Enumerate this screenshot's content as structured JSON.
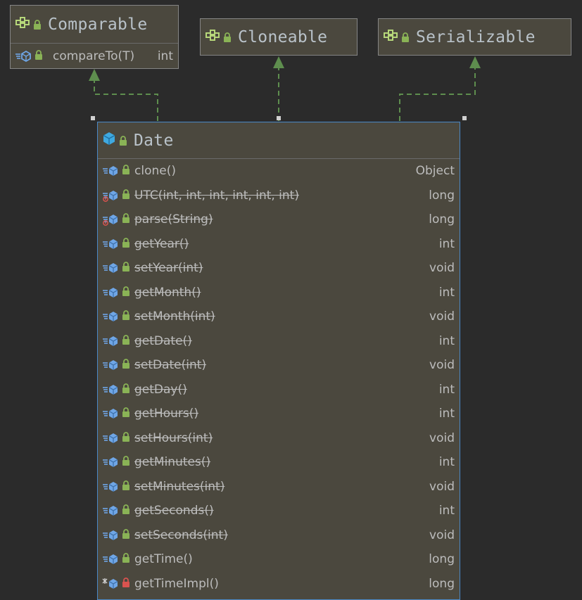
{
  "diagram": {
    "interfaces": [
      {
        "id": "comparable",
        "name": "Comparable",
        "members": [
          {
            "name": "compareTo(T)",
            "type": "int"
          }
        ]
      },
      {
        "id": "cloneable",
        "name": "Cloneable",
        "members": []
      },
      {
        "id": "serializable",
        "name": "Serializable",
        "members": []
      }
    ],
    "class": {
      "name": "Date",
      "methods": [
        {
          "name": "clone()",
          "type": "Object",
          "deprecated": false,
          "mark": ""
        },
        {
          "name": "UTC(int, int, int, int, int, int)",
          "type": "long",
          "deprecated": true,
          "mark": "static"
        },
        {
          "name": "parse(String)",
          "type": "long",
          "deprecated": true,
          "mark": "static"
        },
        {
          "name": "getYear()",
          "type": "int",
          "deprecated": true,
          "mark": ""
        },
        {
          "name": "setYear(int)",
          "type": "void",
          "deprecated": true,
          "mark": ""
        },
        {
          "name": "getMonth()",
          "type": "int",
          "deprecated": true,
          "mark": ""
        },
        {
          "name": "setMonth(int)",
          "type": "void",
          "deprecated": true,
          "mark": ""
        },
        {
          "name": "getDate()",
          "type": "int",
          "deprecated": true,
          "mark": ""
        },
        {
          "name": "setDate(int)",
          "type": "void",
          "deprecated": true,
          "mark": ""
        },
        {
          "name": "getDay()",
          "type": "int",
          "deprecated": true,
          "mark": ""
        },
        {
          "name": "getHours()",
          "type": "int",
          "deprecated": true,
          "mark": ""
        },
        {
          "name": "setHours(int)",
          "type": "void",
          "deprecated": true,
          "mark": ""
        },
        {
          "name": "getMinutes()",
          "type": "int",
          "deprecated": true,
          "mark": ""
        },
        {
          "name": "setMinutes(int)",
          "type": "void",
          "deprecated": true,
          "mark": ""
        },
        {
          "name": "getSeconds()",
          "type": "int",
          "deprecated": true,
          "mark": ""
        },
        {
          "name": "setSeconds(int)",
          "type": "void",
          "deprecated": true,
          "mark": ""
        },
        {
          "name": "getTime()",
          "type": "long",
          "deprecated": false,
          "mark": ""
        },
        {
          "name": "getTimeImpl()",
          "type": "long",
          "deprecated": false,
          "mark": "private"
        }
      ]
    },
    "relations": [
      {
        "from": "Date",
        "to": "Comparable",
        "kind": "implements"
      },
      {
        "from": "Date",
        "to": "Cloneable",
        "kind": "implements"
      },
      {
        "from": "Date",
        "to": "Serializable",
        "kind": "implements"
      }
    ],
    "colors": {
      "background": "#2b2b2b",
      "node_fill": "#4b483e",
      "edge": "#5e8e4e",
      "selection": "#4a88c7",
      "lock": "#8ab356",
      "method_icon": "#6fa6e6"
    }
  }
}
